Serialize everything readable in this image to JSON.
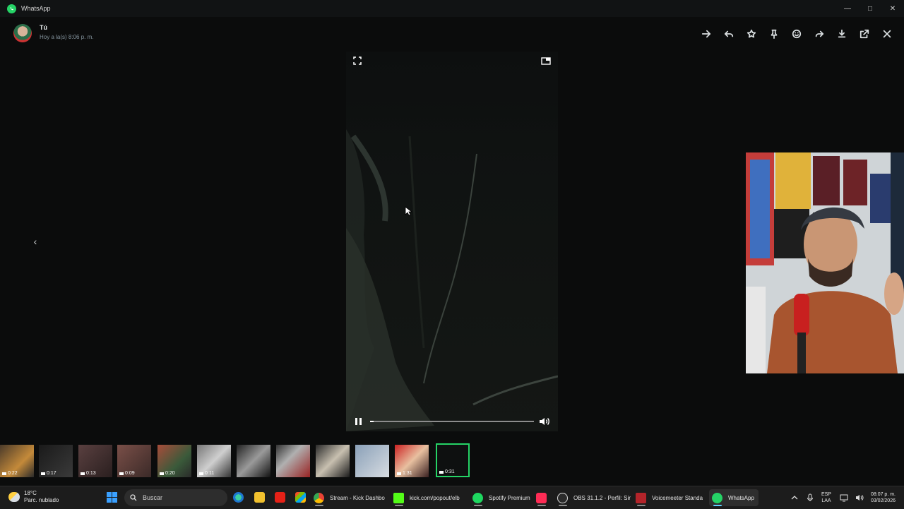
{
  "window": {
    "title": "WhatsApp",
    "controls": [
      "minimize",
      "maximize",
      "close"
    ]
  },
  "header": {
    "sender": "Tú",
    "timestamp": "Hoy a la(s) 8:06 p. m.",
    "toolbar": [
      "arrow-right-icon",
      "reply-icon",
      "star-icon",
      "pin-icon",
      "emoji-icon",
      "forward-icon",
      "download-icon",
      "open-external-icon",
      "close-icon"
    ]
  },
  "player": {
    "progress": 0.02,
    "state": "playing"
  },
  "thumbnails": [
    {
      "duration": "0:22"
    },
    {
      "duration": "0:17"
    },
    {
      "duration": "0:13"
    },
    {
      "duration": "0:09"
    },
    {
      "duration": "0:20"
    },
    {
      "duration": "0:11"
    },
    {
      "duration": ""
    },
    {
      "duration": ""
    },
    {
      "duration": ""
    },
    {
      "duration": ""
    },
    {
      "duration": "1:31"
    },
    {
      "duration": "0:31",
      "selected": true
    }
  ],
  "taskbar": {
    "weather": {
      "temp": "18°C",
      "desc": "Parc. nublado"
    },
    "search_placeholder": "Buscar",
    "apps": [
      {
        "label": "Stream - Kick Dashbo",
        "icon": "chrome-icon"
      },
      {
        "label": "kick.com/popout/elb",
        "icon": "kick-icon"
      },
      {
        "label": "Spotify Premium",
        "icon": "spotify-icon"
      },
      {
        "label": "",
        "icon": "tiktok-icon"
      },
      {
        "label": "OBS 31.1.2 - Perfil: Sin",
        "icon": "obs-icon"
      },
      {
        "label": "Voicemeeter Standa",
        "icon": "voicemeeter-icon"
      },
      {
        "label": "WhatsApp",
        "icon": "whatsapp-icon"
      }
    ],
    "lang": {
      "line1": "ESP",
      "line2": "LAA"
    },
    "clock": {
      "time": "08:07 p. m.",
      "date": "03/02/2026"
    }
  },
  "colors": {
    "accent": "#25d366",
    "background": "#0b0c0c",
    "taskbar": "#1c1c1c"
  }
}
